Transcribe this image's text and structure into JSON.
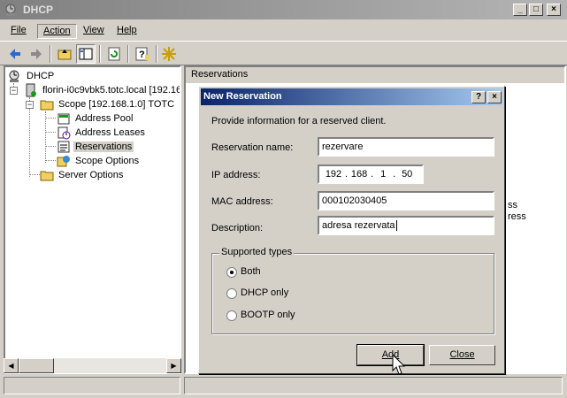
{
  "window": {
    "title": "DHCP",
    "buttons": {
      "minimize": "_",
      "maximize": "□",
      "close": "×"
    }
  },
  "menu": [
    {
      "label": "File"
    },
    {
      "label": "Action"
    },
    {
      "label": "View"
    },
    {
      "label": "Help"
    }
  ],
  "toolbar": {
    "icons": [
      "back-arrow-icon",
      "forward-arrow-icon",
      "up-folder-icon",
      "show-hide-tree-icon",
      "refresh-icon",
      "help-icon",
      "new-star-icon"
    ]
  },
  "tree": {
    "root": "DHCP",
    "server": "florin-i0c9vbk5.totc.local [192.16",
    "scope": "Scope [192.168.1.0] TOTC",
    "items": [
      "Address Pool",
      "Address Leases",
      "Reservations",
      "Scope Options"
    ],
    "server_options": "Server Options"
  },
  "right_pane": {
    "header": "Reservations",
    "ghost_text": [
      "ss",
      "ress"
    ]
  },
  "dialog": {
    "title": "New Reservation",
    "help_btn": "?",
    "close_btn": "×",
    "intro": "Provide information for a reserved client.",
    "labels": {
      "name": "Reservation name:",
      "ip": "IP address:",
      "mac": "MAC address:",
      "desc": "Description:"
    },
    "values": {
      "name": "rezervare",
      "ip": [
        "192",
        "168",
        "1",
        "50"
      ],
      "mac": "000102030405",
      "desc": "adresa rezervata"
    },
    "supported_types": {
      "label": "Supported types",
      "options": [
        "Both",
        "DHCP only",
        "BOOTP only"
      ],
      "selected": "Both"
    },
    "buttons": {
      "add": "Add",
      "close": "Close"
    }
  }
}
